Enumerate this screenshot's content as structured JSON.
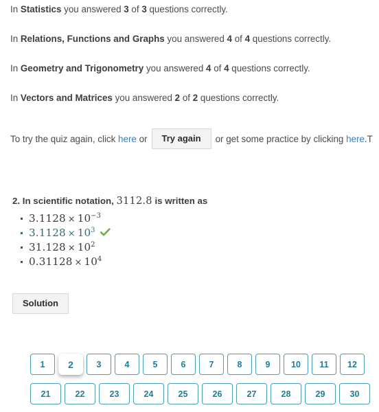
{
  "results": [
    {
      "prefix": "In ",
      "topic": "Statistics",
      "middle": " you answered ",
      "score": "3",
      "of": " of ",
      "total": "3",
      "suffix": " questions correctly."
    },
    {
      "prefix": "In ",
      "topic": "Relations, Functions and Graphs",
      "middle": " you answered ",
      "score": "4",
      "of": " of ",
      "total": "4",
      "suffix": " questions correctly."
    },
    {
      "prefix": "In ",
      "topic": "Geometry and Trigonometry",
      "middle": " you answered ",
      "score": "4",
      "of": " of ",
      "total": "4",
      "suffix": " questions correctly."
    },
    {
      "prefix": "In ",
      "topic": "Vectors and Matrices",
      "middle": " you answered ",
      "score": "2",
      "of": " of ",
      "total": "2",
      "suffix": " questions correctly."
    }
  ],
  "retry": {
    "lead_text": "To try the quiz again, click ",
    "link1_text": "here",
    "mid_text": " or",
    "button_label": "Try again",
    "tail_text": "or get some practice by clicking ",
    "link2_text": "here",
    "period": ".",
    "truncated_tail": "T"
  },
  "question": {
    "number": "2.",
    "text_before": "In scientific notation,",
    "value": "3112.8",
    "text_after": "is written as",
    "options": [
      {
        "mantissa": "3.1128",
        "times": "×",
        "base": "10",
        "exponent": "−3",
        "selected": false,
        "correct_mark": ""
      },
      {
        "mantissa": "3.1128",
        "times": "×",
        "base": "10",
        "exponent": "3",
        "selected": true,
        "correct_mark": "✔"
      },
      {
        "mantissa": "31.128",
        "times": "×",
        "base": "10",
        "exponent": "2",
        "selected": false,
        "correct_mark": ""
      },
      {
        "mantissa": "0.31128",
        "times": "×",
        "base": "10",
        "exponent": "4",
        "selected": false,
        "correct_mark": ""
      }
    ]
  },
  "solution": {
    "label": "Solution"
  },
  "pagination": {
    "active_page": "2",
    "row1": [
      "1",
      "2",
      "3",
      "4",
      "5",
      "6",
      "7",
      "8",
      "9",
      "10",
      "11",
      "12"
    ],
    "row2": [
      "21",
      "22",
      "23",
      "24",
      "25",
      "26",
      "27",
      "28",
      "29",
      "30"
    ]
  },
  "colors": {
    "link": "#3a7ebf",
    "pager_border": "#4a9cb5",
    "pager_text": "#1b7e9e",
    "selected_option": "#2e6a7d",
    "check_green": "#6ab04c",
    "body_text": "#4a4a4a"
  }
}
